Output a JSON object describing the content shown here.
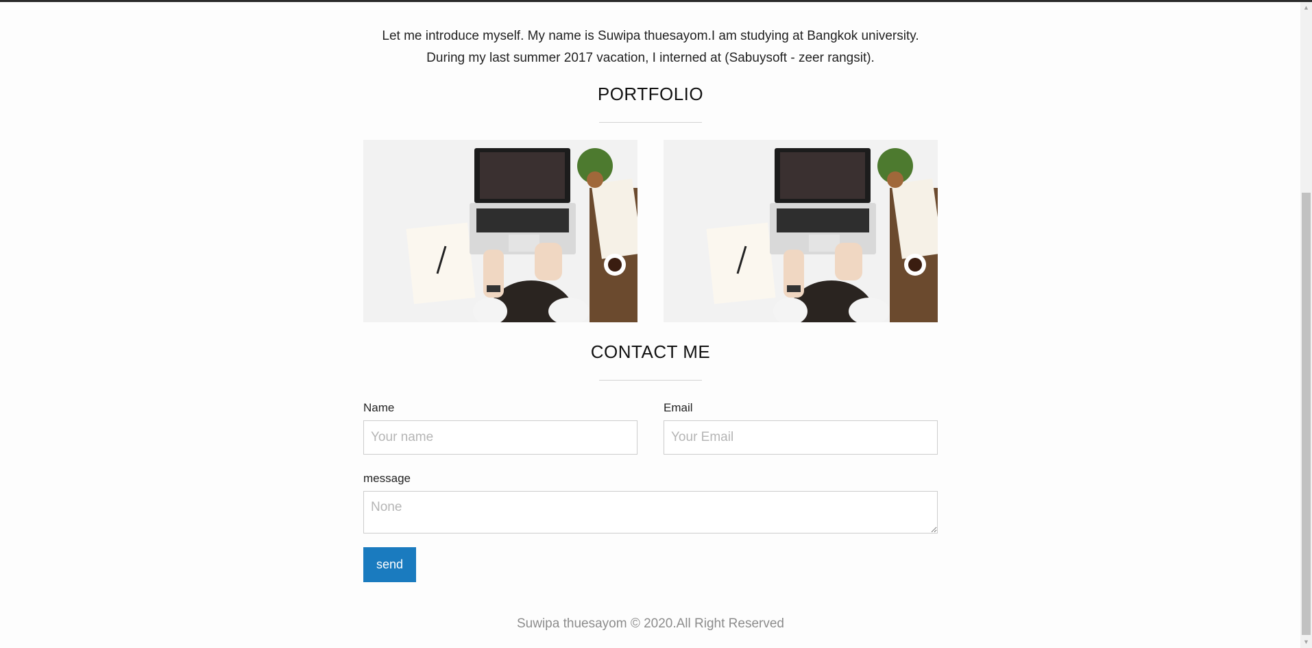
{
  "about": {
    "line1": "Let me introduce myself. My name is Suwipa thuesayom.I am studying at Bangkok university.",
    "line2": "During my last summer 2017 vacation, I interned at (Sabuysoft - zeer rangsit)."
  },
  "portfolio": {
    "title": "PORTFOLIO"
  },
  "contact": {
    "title": "CONTACT ME",
    "name_label": "Name",
    "name_placeholder": "Your name",
    "email_label": "Email",
    "email_placeholder": "Your Email",
    "message_label": "message",
    "message_placeholder": "None",
    "send_label": "send"
  },
  "footer": {
    "text": "Suwipa thuesayom © 2020.All Right Reserved"
  },
  "colors": {
    "button": "#1a7bbf",
    "footer_text": "#8c8c8c",
    "divider": "#d3d3d3"
  }
}
